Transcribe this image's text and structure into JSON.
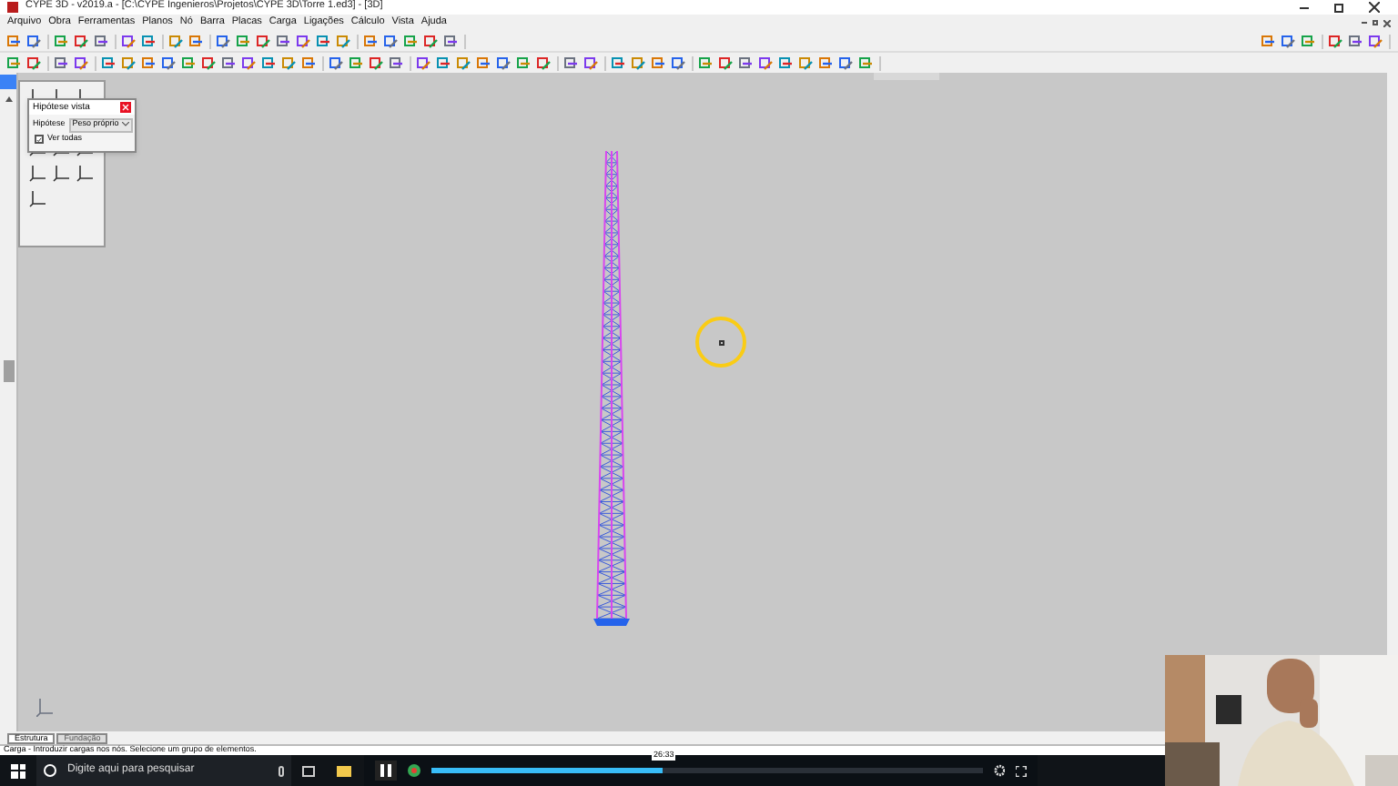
{
  "window": {
    "title": "CYPE 3D - v2019.a - [C:\\CYPE Ingenieros\\Projetos\\CYPE 3D\\Torre 1.ed3] - [3D]"
  },
  "menu": [
    "Arquivo",
    "Obra",
    "Ferramentas",
    "Planos",
    "Nó",
    "Barra",
    "Placas",
    "Carga",
    "Ligações",
    "Cálculo",
    "Vista",
    "Ajuda"
  ],
  "dialog": {
    "title": "Hipótese vista",
    "hypothesis_label": "Hipótese",
    "hypothesis_value": "Peso próprio",
    "show_all": {
      "label": "Ver todas",
      "checked": true
    }
  },
  "tabs": [
    {
      "label": "Estrutura",
      "selected": true
    },
    {
      "label": "Fundação",
      "selected": false
    }
  ],
  "status_bar": "Carga - Introduzir cargas nos nós. Selecione um grupo de elementos.",
  "taskbar": {
    "search_placeholder": "Digite aqui para pesquisar"
  },
  "video_player": {
    "time": "26:33",
    "level": 0.42
  }
}
